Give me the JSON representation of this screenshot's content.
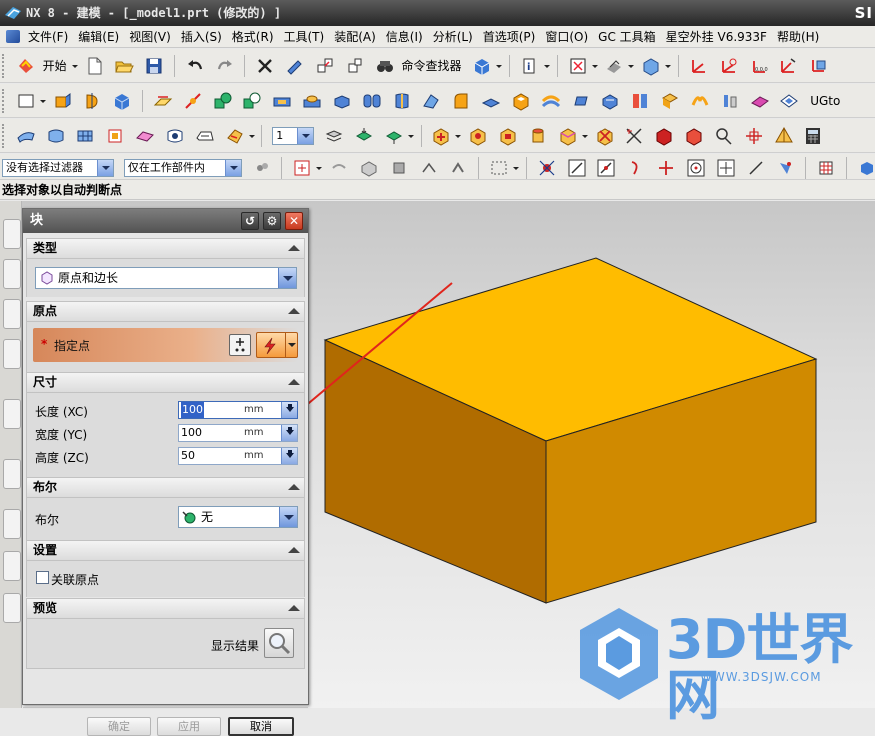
{
  "window": {
    "title": "NX 8 - 建模 - [_model1.prt  (修改的) ]",
    "brand": "SI"
  },
  "menubar": {
    "items": [
      {
        "id": "file",
        "label": "文件(F)"
      },
      {
        "id": "edit",
        "label": "编辑(E)"
      },
      {
        "id": "view",
        "label": "视图(V)"
      },
      {
        "id": "insert",
        "label": "插入(S)"
      },
      {
        "id": "format",
        "label": "格式(R)"
      },
      {
        "id": "tools",
        "label": "工具(T)"
      },
      {
        "id": "assembly",
        "label": "装配(A)"
      },
      {
        "id": "info",
        "label": "信息(I)"
      },
      {
        "id": "analysis",
        "label": "分析(L)"
      },
      {
        "id": "preferences",
        "label": "首选项(P)"
      },
      {
        "id": "window",
        "label": "窗口(O)"
      },
      {
        "id": "gc-toolkit",
        "label": "GC 工具箱"
      },
      {
        "id": "plugin",
        "label": "星空外挂 V6.933F"
      },
      {
        "id": "help",
        "label": "帮助(H)"
      }
    ]
  },
  "toolbar": {
    "start_label": "开始",
    "command_finder_label": "命令查找器",
    "ug_label": "UGto",
    "layer_value": "1"
  },
  "selection_bar": {
    "filter_value": "没有选择过滤器",
    "scope_value": "仅在工作部件内"
  },
  "status": {
    "prompt": "选择对象以自动判断点"
  },
  "dialog": {
    "title": "块",
    "sections": {
      "type": {
        "header": "类型",
        "value": "原点和边长"
      },
      "origin": {
        "header": "原点",
        "required_mark": "*",
        "specify_point_label": "指定点"
      },
      "dimensions": {
        "header": "尺寸",
        "fields": [
          {
            "id": "length",
            "label": "长度 (XC)",
            "value": "100",
            "unit": "mm"
          },
          {
            "id": "width",
            "label": "宽度 (YC)",
            "value": "100",
            "unit": "mm"
          },
          {
            "id": "height",
            "label": "高度 (ZC)",
            "value": "50",
            "unit": "mm"
          }
        ]
      },
      "boolean": {
        "header": "布尔",
        "label": "布尔",
        "value": "无"
      },
      "settings": {
        "header": "设置",
        "associative_origin_label": "关联原点",
        "associative_origin_checked": false
      },
      "preview": {
        "header": "预览",
        "show_result_label": "显示结果"
      }
    },
    "buttons": {
      "ok": "确定",
      "apply": "应用",
      "cancel": "取消"
    }
  },
  "watermark": {
    "text": "3D世界网",
    "url": "WWW.3DSJW.COM"
  },
  "colors": {
    "block_top": "#ffbc00",
    "block_front": "#b06c00",
    "block_side": "#d08a00",
    "annotation_arrow": "#e0251c",
    "watermark": "#5b9be0"
  }
}
